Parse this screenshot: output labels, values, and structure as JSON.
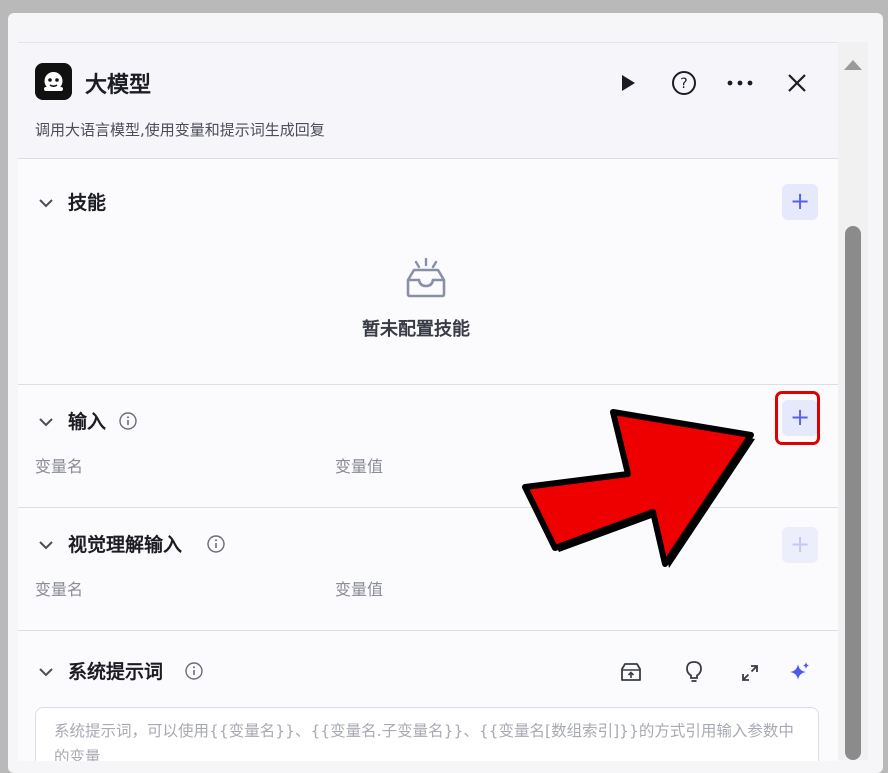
{
  "header": {
    "title": "大模型",
    "subtitle": "调用大语言模型,使用变量和提示词生成回复",
    "logo_icon": "robot-head-icon",
    "run_icon": "play-icon",
    "help_icon": "help-circle-icon",
    "more_icon": "more-dots-icon",
    "close_icon": "close-icon"
  },
  "skills": {
    "title": "技能",
    "empty_text": "暂未配置技能",
    "empty_icon": "empty-box-icon"
  },
  "input": {
    "title": "输入",
    "col_name": "变量名",
    "col_value": "变量值",
    "add_label": "+"
  },
  "vision_input": {
    "title": "视觉理解输入",
    "col_name": "变量名",
    "col_value": "变量值",
    "add_label": "+"
  },
  "system_prompt": {
    "title": "系统提示词",
    "placeholder": "系统提示词，可以使用{{变量名}}、{{变量名.子变量名}}、{{变量名[数组索引]}}的方式引用输入参数中的变量",
    "tools": [
      "library-icon",
      "lightbulb-icon",
      "expand-icon",
      "sparkle-icon"
    ]
  },
  "colors": {
    "accent": "#5a62e6",
    "annotation": "#e00000"
  }
}
